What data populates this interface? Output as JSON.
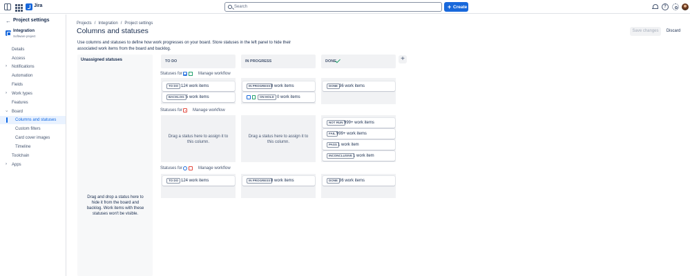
{
  "topbar": {
    "brand": "Jira",
    "search_placeholder": "Search",
    "create_label": "Create"
  },
  "sidebar": {
    "back_title": "Project settings",
    "project_name": "Integration",
    "project_type": "Software project",
    "items": [
      {
        "label": "Details"
      },
      {
        "label": "Access"
      },
      {
        "label": "Notifications"
      },
      {
        "label": "Automation"
      },
      {
        "label": "Fields"
      },
      {
        "label": "Work types"
      },
      {
        "label": "Features"
      },
      {
        "label": "Board"
      },
      {
        "label": "Columns and statuses"
      },
      {
        "label": "Custom filters"
      },
      {
        "label": "Card cover images"
      },
      {
        "label": "Timeline"
      },
      {
        "label": "Toolchain"
      },
      {
        "label": "Apps"
      }
    ]
  },
  "breadcrumb": [
    "Projects",
    "Integration",
    "Project settings"
  ],
  "page": {
    "title": "Columns and statuses",
    "save_label": "Save changes",
    "discard_label": "Discard",
    "description": "Use columns and statuses to define how work progresses on your board. Store statuses in the left panel to hide their associated work items from the board and backlog."
  },
  "unassigned": {
    "title": "Unassigned statuses",
    "message": "Drag and drop a status here to hide it from the board and backlog. Work items with these statuses won't be visible."
  },
  "columns": [
    "TO DO",
    "IN PROGRESS",
    "DONE"
  ],
  "workflows": [
    {
      "label": "Statuses for",
      "manage": "Manage workflow",
      "todo": [
        {
          "status": "TO DO",
          "count": "124 work items"
        },
        {
          "status": "BACKLOG",
          "count": "5 work items"
        }
      ],
      "inprogress": [
        {
          "status": "IN PROGRESS",
          "count": "8 work items"
        },
        {
          "status": "ON HOLD",
          "count": "0 work items"
        }
      ],
      "done": [
        {
          "status": "DONE",
          "count": "36 work items"
        }
      ]
    },
    {
      "label": "Statuses for",
      "manage": "Manage workflow",
      "todo_drop": "Drag a status here to assign it to this column.",
      "inprogress_drop": "Drag a status here to assign it to this column.",
      "done": [
        {
          "status": "NOT RUN",
          "count": "999+ work items"
        },
        {
          "status": "FAIL",
          "count": "999+ work items"
        },
        {
          "status": "PASS",
          "count": "1 work item"
        },
        {
          "status": "INCONCLUSIVE",
          "count": "1 work item"
        }
      ]
    },
    {
      "label": "Statuses for",
      "manage": "Manage workflow",
      "todo": [
        {
          "status": "TO DO",
          "count": "124 work items"
        }
      ],
      "inprogress": [
        {
          "status": "IN PROGRESS",
          "count": "8 work items"
        }
      ],
      "done": [
        {
          "status": "DONE",
          "count": "36 work items"
        }
      ]
    }
  ]
}
